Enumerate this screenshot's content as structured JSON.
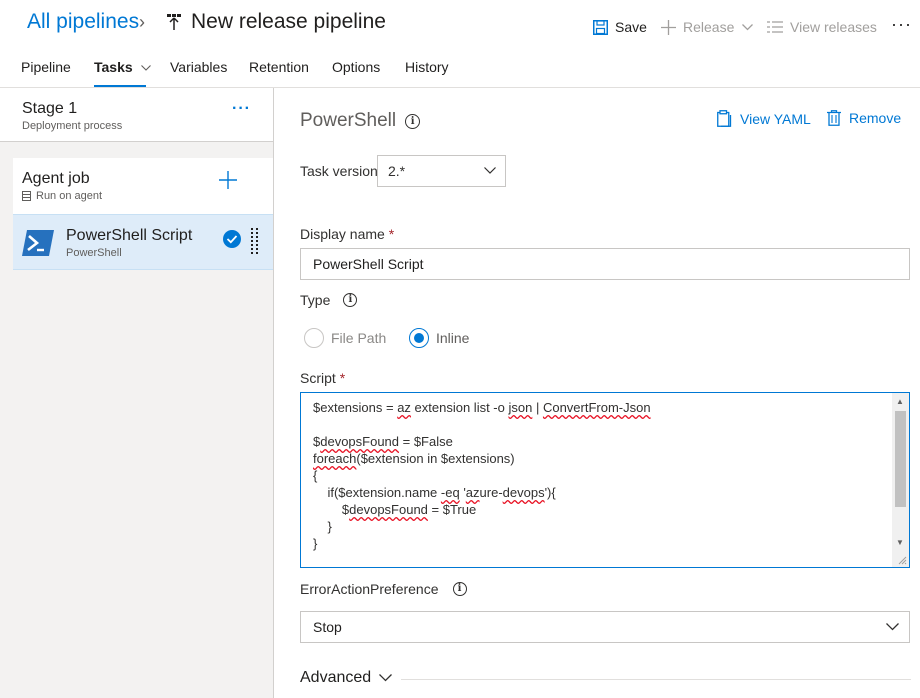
{
  "header": {
    "breadcrumb": "All pipelines",
    "title": "New release pipeline",
    "save_label": "Save",
    "release_label": "Release",
    "view_releases_label": "View releases",
    "more_label": "···"
  },
  "tabs": [
    {
      "label": "Pipeline"
    },
    {
      "label": "Tasks",
      "active": true
    },
    {
      "label": "Variables"
    },
    {
      "label": "Retention"
    },
    {
      "label": "Options"
    },
    {
      "label": "History"
    }
  ],
  "left": {
    "stage": {
      "title": "Stage 1",
      "subtitle": "Deployment process",
      "more": "···"
    },
    "agent_job": {
      "title": "Agent job",
      "subtitle": "Run on agent"
    },
    "task": {
      "title": "PowerShell Script",
      "subtitle": "PowerShell"
    }
  },
  "panel": {
    "title": "PowerShell",
    "view_yaml": "View YAML",
    "remove": "Remove",
    "task_version_label": "Task version",
    "task_version_value": "2.*",
    "display_name_label": "Display name",
    "display_name_value": "PowerShell Script",
    "required_mark": "*",
    "type_label": "Type",
    "type_options": [
      "File Path",
      "Inline"
    ],
    "type_selected": "Inline",
    "script_label": "Script",
    "script_lines": [
      "$extensions = az extension list -o json | ConvertFrom-Json",
      "",
      "$devopsFound = $False",
      "foreach($extension in $extensions)",
      "{",
      "    if($extension.name -eq 'azure-devops'){",
      "        $devopsFound = $True",
      "    }",
      "}"
    ],
    "eap_label": "ErrorActionPreference",
    "eap_value": "Stop",
    "advanced_label": "Advanced"
  },
  "colors": {
    "accent": "#0078d4",
    "selected_bg": "#deecf9",
    "required": "#a4262c",
    "spell_squiggle": "#e81123"
  }
}
